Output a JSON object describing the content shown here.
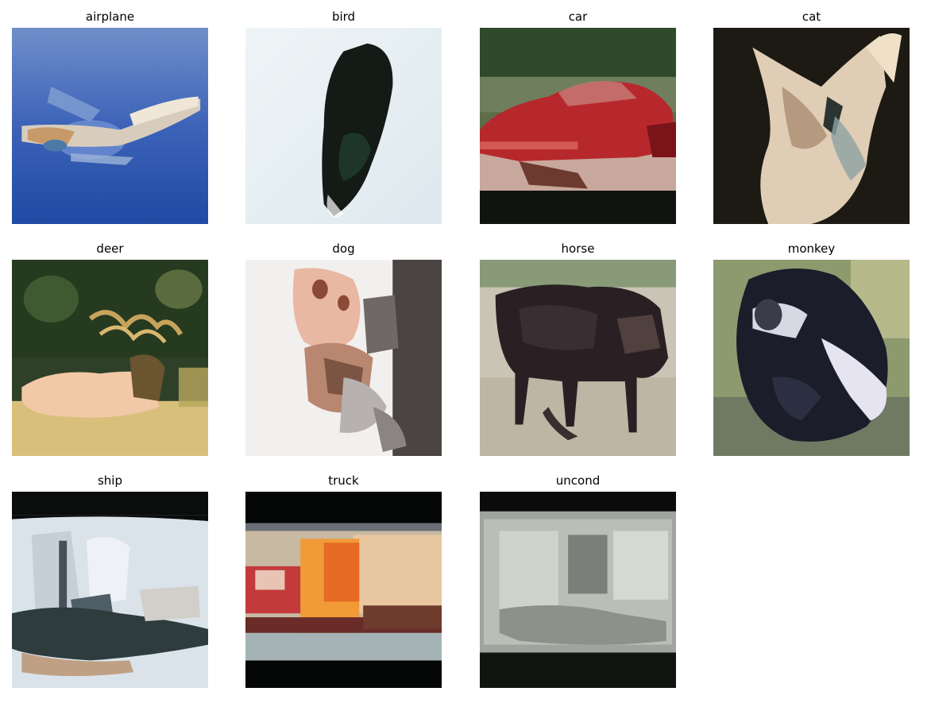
{
  "panels": [
    {
      "label": "airplane"
    },
    {
      "label": "bird"
    },
    {
      "label": "car"
    },
    {
      "label": "cat"
    },
    {
      "label": "deer"
    },
    {
      "label": "dog"
    },
    {
      "label": "horse"
    },
    {
      "label": "monkey"
    },
    {
      "label": "ship"
    },
    {
      "label": "truck"
    },
    {
      "label": "uncond"
    }
  ]
}
